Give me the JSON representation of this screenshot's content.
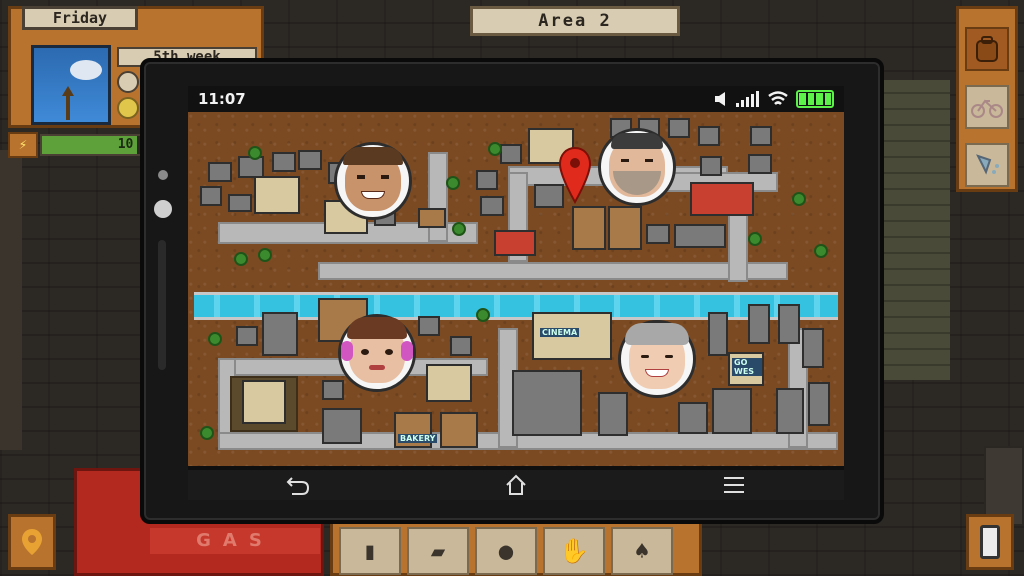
{
  "hud": {
    "day": "Friday",
    "week": "5th week",
    "energy_value": "10",
    "energy_level": 0.9
  },
  "area": {
    "label": "Area 2"
  },
  "phone": {
    "time": "11:07",
    "battery_cells": 4
  },
  "map": {
    "labels": {
      "cinema": "CINEMA",
      "gowes": "GO WES",
      "bakery": "BAKERY"
    }
  },
  "background": {
    "gas_sign": "GAS"
  },
  "icons": {
    "energy": "lightning-icon",
    "map": "map-pin-icon",
    "phone": "phone-icon",
    "back": "back-arrow-icon",
    "home": "home-icon",
    "menu": "menu-icon"
  },
  "colors": {
    "hud_orange": "#b8732f",
    "map_pin": "#e02a1c",
    "river": "#34c2e0",
    "battery": "#5cf24a"
  }
}
